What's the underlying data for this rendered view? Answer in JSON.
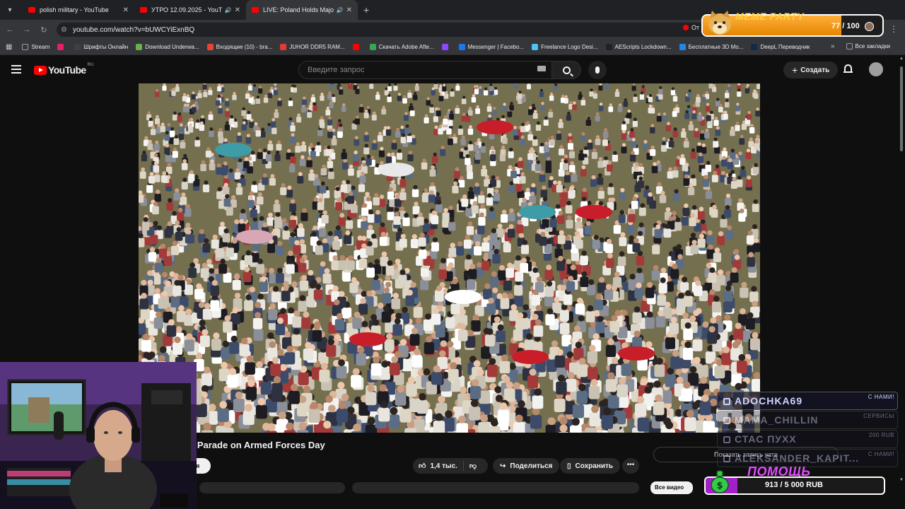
{
  "browser": {
    "tabs": [
      {
        "title": "polish military - YouTube",
        "audio": false
      },
      {
        "title": "УТРО 12.09.2025 - YouTube",
        "audio": true
      },
      {
        "title": "LIVE: Poland Holds Major M",
        "audio": true
      }
    ],
    "url": "youtube.com/watch?v=bUWCYiExnBQ",
    "omni_right_text": "От",
    "bookmarks": [
      {
        "label": "Stream",
        "color": "#9aa0a6"
      },
      {
        "label": "",
        "color": "#e91e63"
      },
      {
        "label": "Шрифты Онлайн",
        "color": "#3c4043"
      },
      {
        "label": "Download Underwa...",
        "color": "#6ab04c"
      },
      {
        "label": "Входящие (10) - bra...",
        "color": "#ea4335"
      },
      {
        "label": "JUHOR DDR5 RAM...",
        "color": "#e53935"
      },
      {
        "label": "",
        "color": "#ff0000"
      },
      {
        "label": "Скачать Adobe Afte...",
        "color": "#34a853"
      },
      {
        "label": "",
        "color": "#9146ff"
      },
      {
        "label": "Messenger | Facebo...",
        "color": "#1877f2"
      },
      {
        "label": "Freelance Logo Desi...",
        "color": "#4fc3f7"
      },
      {
        "label": "AEScripts Lockdown...",
        "color": "#222222"
      },
      {
        "label": "Бесплатные 3D Мо...",
        "color": "#1e88e5"
      },
      {
        "label": "DeepL Переводчик",
        "color": "#0f2b46"
      }
    ],
    "bookmarks_all": "Все закладки"
  },
  "youtube": {
    "logo_text": "YouTube",
    "region": "RU",
    "search_placeholder": "Введите запрос",
    "create_label": "Создать"
  },
  "video": {
    "title": "y Parade on Armed Forces Day",
    "subscribe_partial": "ся",
    "likes": "1,4 тыс.",
    "share_label": "Поделиться",
    "save_label": "Сохранить",
    "more_label": "•••",
    "show_chat_label": "Показать запись чата",
    "chip_label": "Все видео"
  },
  "overlay": {
    "meme_title": "MEME PARTY",
    "meme_count": "77 / 100",
    "meme_progress": 0.77,
    "feed": [
      {
        "name": "ADOCHKA69",
        "tag": "С НАМИ!",
        "dim": false
      },
      {
        "name": "MAMA_CHILLIN",
        "tag": "СЕРВИСЫ",
        "dim": true
      },
      {
        "name": "СТАС ПУХХ",
        "tag": "200 RUB",
        "dim": true
      },
      {
        "name": "ALEKSANDER_KAPIT...",
        "tag": "С НАМИ!",
        "dim": true
      }
    ],
    "goal_title": "ПОМОЩЬ",
    "goal_text": "913 / 5 000 RUB",
    "goal_progress": 0.18
  }
}
